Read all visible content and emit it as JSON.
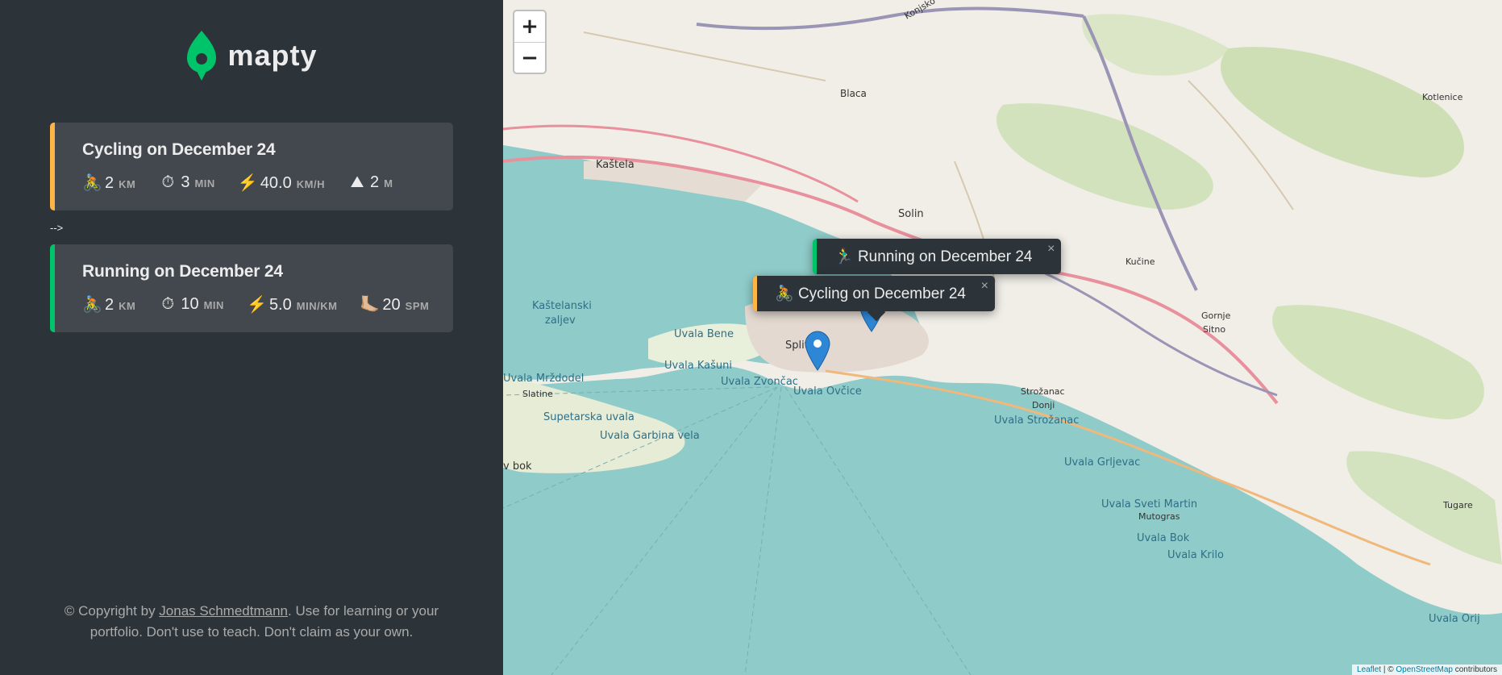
{
  "app": {
    "logo_text": "mapty"
  },
  "workouts": [
    {
      "type": "cycling",
      "title": "Cycling on December 24",
      "details": [
        {
          "icon": "🚴",
          "value": "2",
          "unit": "km"
        },
        {
          "icon": "⏱",
          "value": "3",
          "unit": "min"
        },
        {
          "icon": "⚡️",
          "value": "40.0",
          "unit": "km/h"
        },
        {
          "icon": "⛰",
          "value": "2",
          "unit": "m"
        }
      ]
    },
    {
      "type": "running",
      "title": "Running on December 24",
      "details": [
        {
          "icon": "🚴",
          "value": "2",
          "unit": "km"
        },
        {
          "icon": "⏱",
          "value": "10",
          "unit": "min"
        },
        {
          "icon": "⚡️",
          "value": "5.0",
          "unit": "min/km"
        },
        {
          "icon": "🦶🏼",
          "value": "20",
          "unit": "spm"
        }
      ]
    }
  ],
  "separator_text": "-->",
  "footer": {
    "prefix": "© Copyright by ",
    "author": "Jonas Schmedtmann",
    "suffix": ". Use for learning or your portfolio. Don't use to teach. Don't claim as your own."
  },
  "map": {
    "zoom_in": "+",
    "zoom_out": "−",
    "popups": [
      {
        "icon": "🏃‍♂️",
        "text": "Running on December 24",
        "close": "×"
      },
      {
        "icon": "🚴",
        "text": "Cycling on December 24",
        "close": "×"
      }
    ],
    "places": [
      "Kaštela",
      "Solin",
      "Blaca",
      "Kaštelanski",
      "zaljev",
      "Split",
      "Uvala Bene",
      "Uvala Kašuni",
      "Uvala Zvončac",
      "Uvala Ovčice",
      "Supetarska uvala",
      "Uvala Garbina vela",
      "Uvala Mrždodel",
      "Slatine",
      "Kučine",
      "Gornje",
      "Sitno",
      "Strožanac",
      "Donji",
      "Uvala Strožanac",
      "Uvala Grljevac",
      "Uvala Sveti Martin",
      "Mutogras",
      "Uvala Bok",
      "Uvala Krilo",
      "Tugare",
      "Uvala Orij",
      "Kotlenice",
      "Konjsko",
      "v bok"
    ],
    "attribution": {
      "leaflet": "Leaflet",
      "sep": " | © ",
      "osm": "OpenStreetMap",
      "tail": " contributors"
    }
  },
  "colors": {
    "cycling": "#ffb545",
    "running": "#00c46a",
    "sidebar": "#2d3439",
    "card": "#42484d"
  }
}
